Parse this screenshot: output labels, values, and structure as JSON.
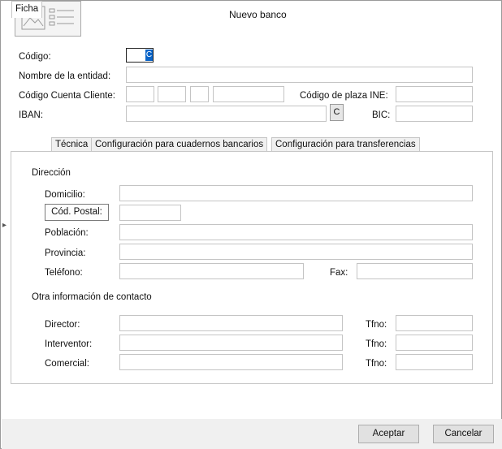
{
  "window": {
    "title": "Nuevo banco"
  },
  "header": {
    "codigo_label": "Código:",
    "codigo_value": "",
    "codigo_caret": "C",
    "nombre_label": "Nombre de la entidad:",
    "ccc_label": "Código Cuenta Cliente:",
    "plaza_label": "Código de plaza INE:",
    "iban_label": "IBAN:",
    "iban_button": "C",
    "bic_label": "BIC:"
  },
  "tabs": [
    {
      "label": "Ficha",
      "active": true
    },
    {
      "label": "Técnica",
      "active": false
    },
    {
      "label": "Configuración para cuadernos bancarios",
      "active": false
    },
    {
      "label": "Configuración para transferencias",
      "active": false
    }
  ],
  "ficha": {
    "direccion_heading": "Dirección",
    "domicilio_label": "Domicilio:",
    "postal_button": "Cód. Postal:",
    "poblacion_label": "Población:",
    "provincia_label": "Provincia:",
    "telefono_label": "Teléfono:",
    "fax_label": "Fax:",
    "contacto_heading": "Otra información de contacto",
    "director_label": "Director:",
    "interventor_label": "Interventor:",
    "comercial_label": "Comercial:",
    "tfno_label": "Tfno:"
  },
  "footer": {
    "accept": "Aceptar",
    "cancel": "Cancelar"
  },
  "icons": {
    "logo": "image-placeholder-icon",
    "side": "chevron-right-icon"
  }
}
